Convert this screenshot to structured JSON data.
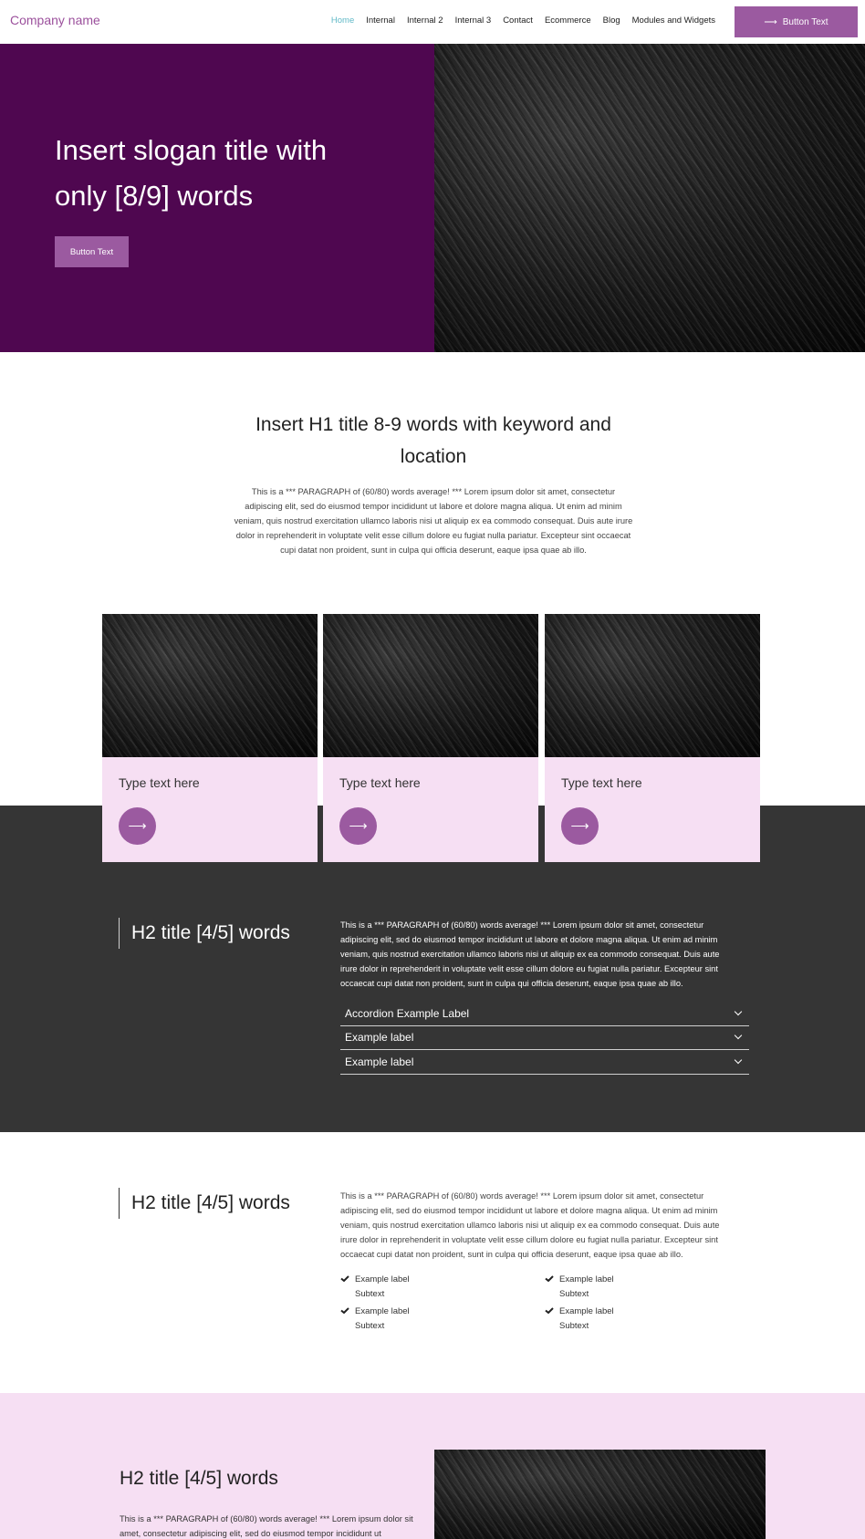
{
  "nav": {
    "brand": "Company name",
    "items": [
      "Home",
      "Internal",
      "Internal 2",
      "Internal 3",
      "Contact",
      "Ecommerce",
      "Blog",
      "Modules and Widgets"
    ],
    "cta_label": "Button Text"
  },
  "hero": {
    "title": "Insert slogan title with only [8/9] words",
    "button_label": "Button Text"
  },
  "intro": {
    "title": "Insert H1 title 8-9 words with keyword and location",
    "paragraph": "This is a *** PARAGRAPH of (60/80) words average! *** Lorem ipsum dolor sit amet, consectetur adipiscing elit, sed do eiusmod tempor incididunt ut labore et dolore magna aliqua. Ut enim ad minim veniam, quis nostrud exercitation ullamco laboris nisi ut aliquip ex ea commodo consequat. Duis aute irure dolor in reprehenderit in voluptate velit esse cillum dolore eu fugiat nulla pariatur. Excepteur sint occaecat cupi datat non proident, sunt in culpa qui officia deserunt, eaque ipsa quae ab illo."
  },
  "cards": [
    {
      "label": "Type text here"
    },
    {
      "label": "Type text here"
    },
    {
      "label": "Type text here"
    }
  ],
  "dark_section": {
    "title": "H2 title [4/5] words",
    "paragraph": "This is a *** PARAGRAPH of (60/80) words average! *** Lorem ipsum dolor sit amet, consectetur adipiscing elit, sed do eiusmod tempor incididunt ut labore et dolore magna aliqua. Ut enim ad minim veniam, quis nostrud exercitation ullamco laboris nisi ut aliquip ex ea commodo consequat. Duis aute irure dolor in reprehenderit in voluptate velit esse cillum dolore eu fugiat nulla pariatur. Excepteur sint occaecat cupi datat non proident, sunt in culpa qui officia deserunt, eaque ipsa quae ab illo.",
    "accordion": [
      "Accordion Example Label",
      "Example label",
      "Example label"
    ]
  },
  "features_section": {
    "title": "H2 title [4/5] words",
    "paragraph": "This is a *** PARAGRAPH of (60/80) words average! *** Lorem ipsum dolor sit amet, consectetur adipiscing elit, sed do eiusmod tempor incididunt ut labore et dolore magna aliqua. Ut enim ad minim veniam, quis nostrud exercitation ullamco laboris nisi ut aliquip ex ea commodo consequat. Duis aute irure dolor in reprehenderit in voluptate velit esse cillum dolore eu fugiat nulla pariatur. Excepteur sint occaecat cupi datat non proident, sunt in culpa qui officia deserunt, eaque ipsa quae ab illo.",
    "features": [
      {
        "label": "Example label",
        "subtext": "Subtext"
      },
      {
        "label": "Example label",
        "subtext": "Subtext"
      },
      {
        "label": "Example label",
        "subtext": "Subtext"
      },
      {
        "label": "Example label",
        "subtext": "Subtext"
      }
    ]
  },
  "pink_section": {
    "title": "H2 title [4/5] words",
    "paragraph": "This is a *** PARAGRAPH of (60/80) words average! *** Lorem ipsum dolor sit amet, consectetur adipiscing elit, sed do eiusmod tempor incididunt ut"
  },
  "colors": {
    "brand_purple": "#9b5aa0",
    "hero_bg": "#4f0750",
    "pink_bg": "#f6dff3",
    "dark_bg": "#353535",
    "active_link": "#61b9c7"
  }
}
